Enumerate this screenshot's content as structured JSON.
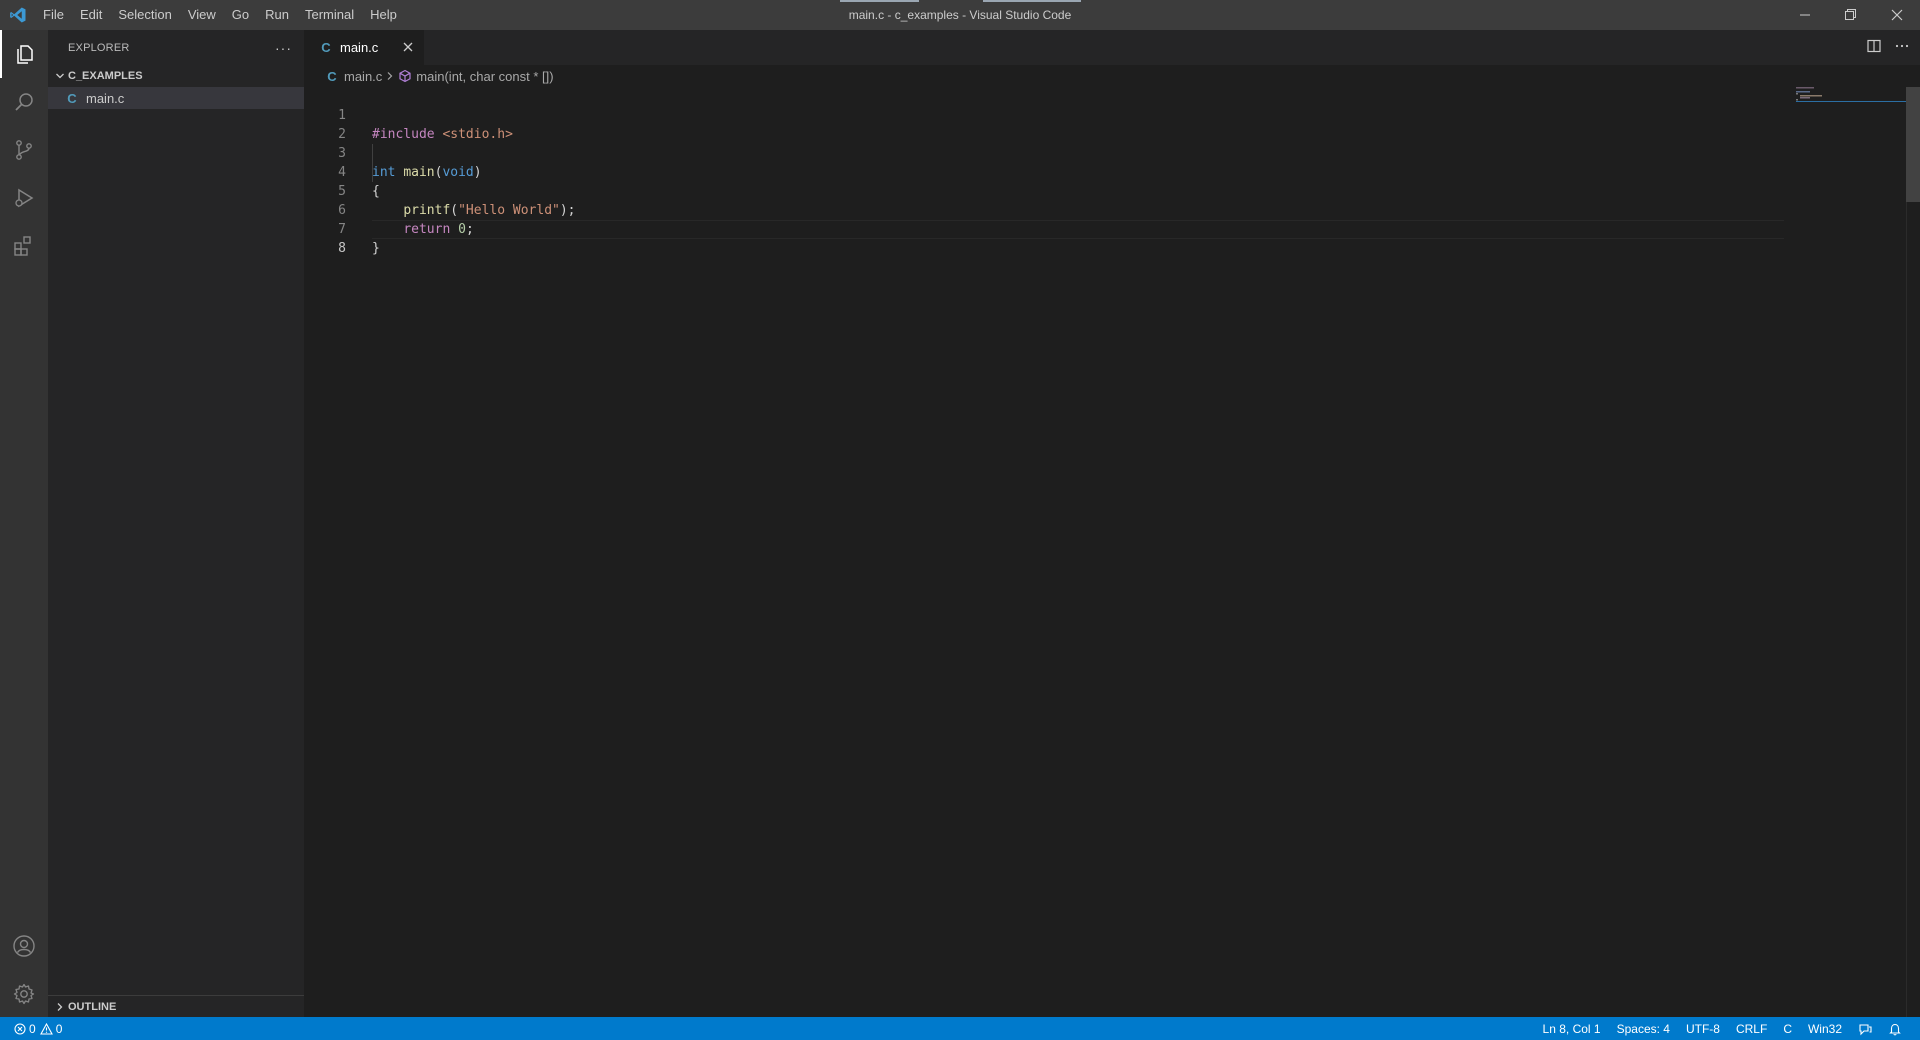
{
  "window": {
    "title": "main.c - c_examples - Visual Studio Code",
    "menu": [
      "File",
      "Edit",
      "Selection",
      "View",
      "Go",
      "Run",
      "Terminal",
      "Help"
    ]
  },
  "activity_bar": {
    "items": [
      "explorer-icon",
      "search-icon",
      "source-control-icon",
      "run-debug-icon",
      "extensions-icon"
    ],
    "bottom_items": [
      "account-icon",
      "settings-gear-icon"
    ]
  },
  "sidebar": {
    "title": "EXPLORER",
    "more": "···",
    "folder": "C_EXAMPLES",
    "files": [
      {
        "icon": "C",
        "name": "main.c"
      }
    ],
    "outline": "OUTLINE"
  },
  "editor": {
    "tab": {
      "icon": "C",
      "label": "main.c"
    },
    "breadcrumb": {
      "file": "main.c",
      "symbol": "main(int, char const * [])"
    },
    "lines": [
      {
        "n": "1",
        "text": "#include <stdio.h>"
      },
      {
        "n": "2",
        "text": ""
      },
      {
        "n": "3",
        "text": "int main(void)"
      },
      {
        "n": "4",
        "text": "{"
      },
      {
        "n": "5",
        "text": "    printf(\"Hello World\");"
      },
      {
        "n": "6",
        "text": "    return 0;"
      },
      {
        "n": "7",
        "text": "}"
      },
      {
        "n": "8",
        "text": ""
      }
    ],
    "current_line": 8
  },
  "status": {
    "errors": "0",
    "warnings": "0",
    "position": "Ln 8, Col 1",
    "spaces": "Spaces: 4",
    "encoding": "UTF-8",
    "eol": "CRLF",
    "language": "C",
    "platform": "Win32"
  },
  "colors": {
    "accent": "#007acc",
    "activity_bar": "#333333",
    "sidebar": "#252526",
    "editor": "#1e1e1e",
    "titlebar": "#3c3c3c"
  }
}
